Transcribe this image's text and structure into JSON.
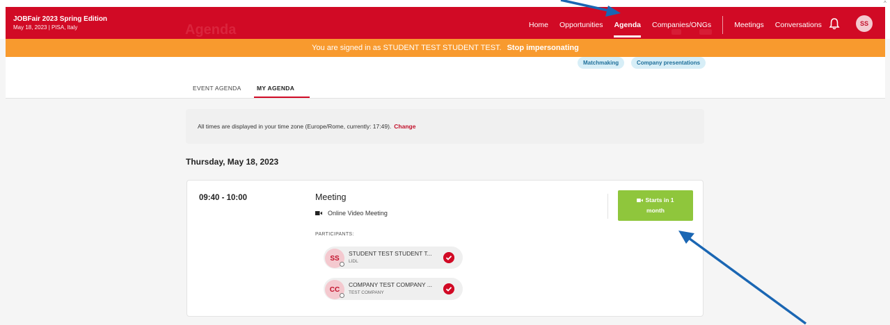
{
  "brand": {
    "title": "JOBFair 2023 Spring Edition",
    "subtitle": "May 18, 2023 | PISA, Italy"
  },
  "nav": {
    "items": [
      "Home",
      "Opportunities",
      "Agenda",
      "Companies/ONGs"
    ],
    "items2": [
      "Meetings",
      "Conversations"
    ],
    "active": "Agenda",
    "avatar_initials": "SS"
  },
  "ghost": {
    "page_title": "Agenda"
  },
  "impersonation": {
    "text": "You are signed in as STUDENT TEST STUDENT TEST.",
    "stop_label": "Stop impersonating"
  },
  "filters": {
    "matchmaking": "Matchmaking",
    "company_presentations": "Company presentations"
  },
  "tabs": {
    "event_agenda": "EVENT AGENDA",
    "my_agenda": "MY AGENDA"
  },
  "timezone": {
    "text": "All times are displayed in your time zone (Europe/Rome, currently: 17:49).",
    "change_label": "Change"
  },
  "date_heading": "Thursday, May 18, 2023",
  "meeting": {
    "time": "09:40 - 10:00",
    "title": "Meeting",
    "type": "Online Video Meeting",
    "participants_label": "PARTICIPANTS:",
    "participants": [
      {
        "initials": "SS",
        "name": "STUDENT TEST STUDENT T...",
        "org": "LIDL"
      },
      {
        "initials": "CC",
        "name": "COMPANY TEST COMPANY ...",
        "org": "TEST COMPANY"
      }
    ],
    "starts_line1": "Starts in 1",
    "starts_line2": "month"
  },
  "colors": {
    "brand_red": "#d10a25",
    "impersonation_orange": "#f89a2e",
    "start_green": "#8fc63c",
    "annotation_blue": "#1a66b3"
  }
}
